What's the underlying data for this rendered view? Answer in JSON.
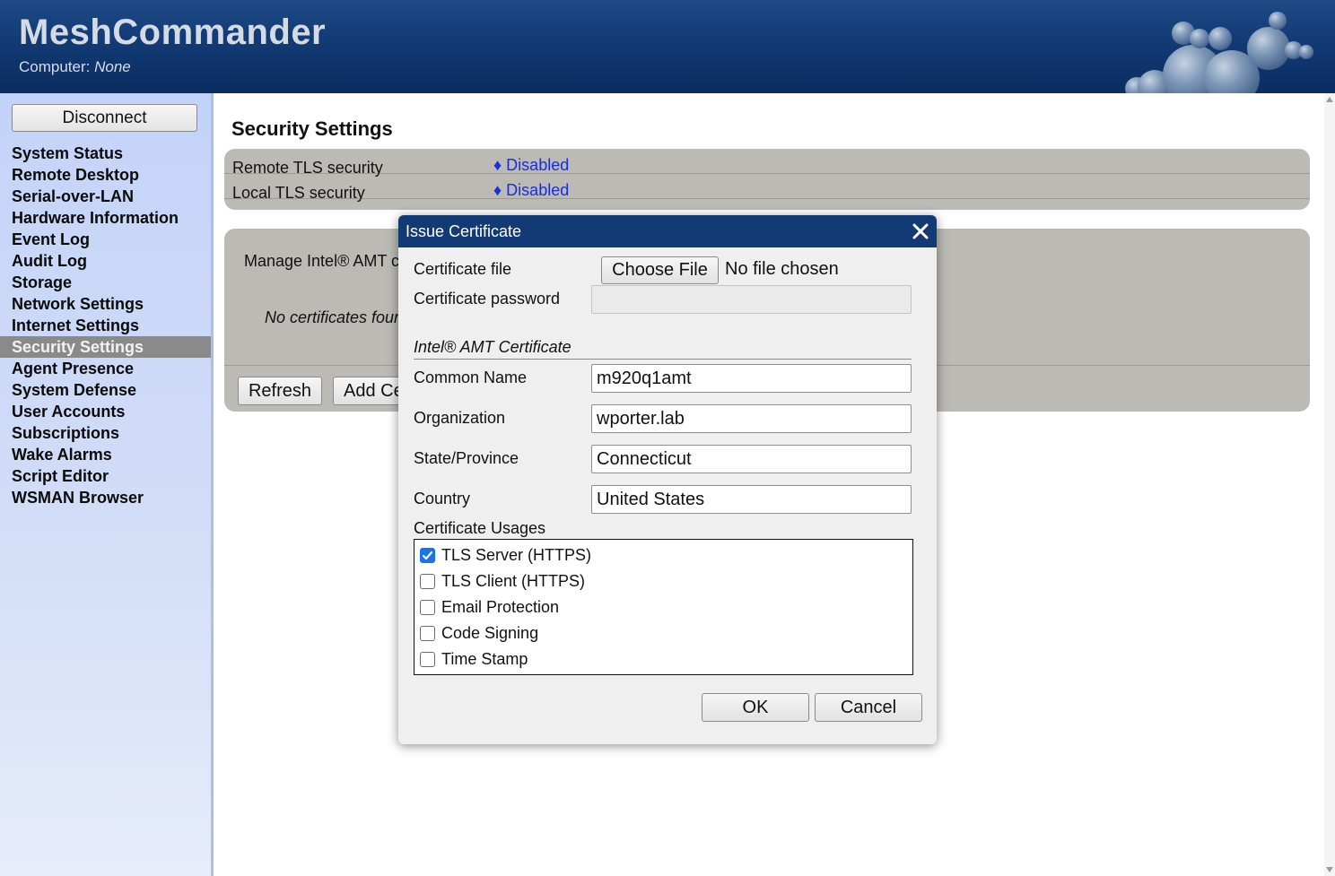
{
  "header": {
    "app_title": "MeshCommander",
    "computer_label": "Computer:",
    "computer_value": "None"
  },
  "sidebar": {
    "disconnect_label": "Disconnect",
    "items": [
      {
        "label": "System Status"
      },
      {
        "label": "Remote Desktop"
      },
      {
        "label": "Serial-over-LAN"
      },
      {
        "label": "Hardware Information"
      },
      {
        "label": "Event Log"
      },
      {
        "label": "Audit Log"
      },
      {
        "label": "Storage"
      },
      {
        "label": "Network Settings"
      },
      {
        "label": "Internet Settings"
      },
      {
        "label": "Security Settings",
        "active": true
      },
      {
        "label": "Agent Presence"
      },
      {
        "label": "System Defense"
      },
      {
        "label": "User Accounts"
      },
      {
        "label": "Subscriptions"
      },
      {
        "label": "Wake Alarms"
      },
      {
        "label": "Script Editor"
      },
      {
        "label": "WSMAN Browser"
      }
    ]
  },
  "main": {
    "page_title": "Security Settings",
    "tls": {
      "remote_label": "Remote TLS security",
      "remote_value": "♦ Disabled",
      "local_label": "Local TLS security",
      "local_value": "♦ Disabled"
    },
    "certs": {
      "manage_text": "Manage Intel® AMT c",
      "no_certs_text": "No certificates four",
      "refresh_label": "Refresh",
      "add_label": "Add Ce"
    }
  },
  "dialog": {
    "title": "Issue Certificate",
    "close_icon": "close-icon",
    "certificate_file_label": "Certificate file",
    "choose_file_label": "Choose File",
    "file_status": "No file chosen",
    "certificate_password_label": "Certificate password",
    "certificate_password_value": "",
    "section_title": "Intel® AMT Certificate",
    "common_name_label": "Common Name",
    "common_name_value": "m920q1amt",
    "organization_label": "Organization",
    "organization_value": "wporter.lab",
    "state_label": "State/Province",
    "state_value": "Connecticut",
    "country_label": "Country",
    "country_value": "United States",
    "usages_label": "Certificate Usages",
    "usages": [
      {
        "label": "TLS Server (HTTPS)",
        "checked": true
      },
      {
        "label": "TLS Client (HTTPS)",
        "checked": false
      },
      {
        "label": "Email Protection",
        "checked": false
      },
      {
        "label": "Code Signing",
        "checked": false
      },
      {
        "label": "Time Stamp",
        "checked": false
      }
    ],
    "ok_label": "OK",
    "cancel_label": "Cancel"
  },
  "colors": {
    "header_bg": "#123a74",
    "sidebar_bg": "#c3d3f8",
    "active_nav_bg": "#8a8a8a",
    "panel_bg": "#bbbab5",
    "link_blue": "#1a2fd6",
    "checkbox_blue": "#1a73e8"
  }
}
